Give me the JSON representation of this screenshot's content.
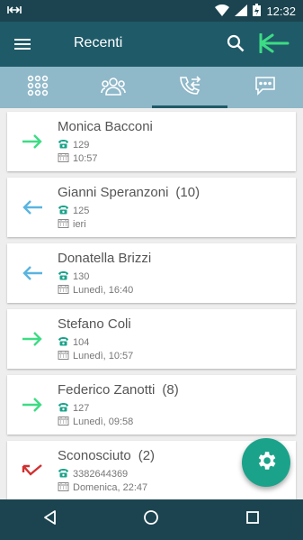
{
  "statusbar": {
    "time": "12:32"
  },
  "appbar": {
    "title": "Recenti"
  },
  "tabs": [
    {
      "name": "tab-dialpad",
      "icon": "dialpad-icon",
      "active": false
    },
    {
      "name": "tab-contacts",
      "icon": "contacts-icon",
      "active": false
    },
    {
      "name": "tab-recent-calls",
      "icon": "recent-calls-icon",
      "active": true
    },
    {
      "name": "tab-messages",
      "icon": "chat-icon",
      "active": false
    }
  ],
  "calls": [
    {
      "name": "Monica Bacconi",
      "count": "",
      "number": "129",
      "date": "10:57",
      "direction": "outgoing"
    },
    {
      "name": "Gianni Speranzoni",
      "count": "(10)",
      "number": "125",
      "date": "ieri",
      "direction": "incoming"
    },
    {
      "name": "Donatella Brizzi",
      "count": "",
      "number": "130",
      "date": "Lunedì, 16:40",
      "direction": "incoming"
    },
    {
      "name": "Stefano Coli",
      "count": "",
      "number": "104",
      "date": "Lunedì, 10:57",
      "direction": "outgoing"
    },
    {
      "name": "Federico Zanotti",
      "count": "(8)",
      "number": "127",
      "date": "Lunedì, 09:58",
      "direction": "outgoing"
    },
    {
      "name": "Sconosciuto",
      "count": "(2)",
      "number": "3382644369",
      "date": "Domenica, 22:47",
      "direction": "missed"
    }
  ],
  "colors": {
    "outgoing": "#3ddc84",
    "incoming": "#5ab4e0",
    "missed": "#d32f2f",
    "accent": "#1aa38a"
  }
}
